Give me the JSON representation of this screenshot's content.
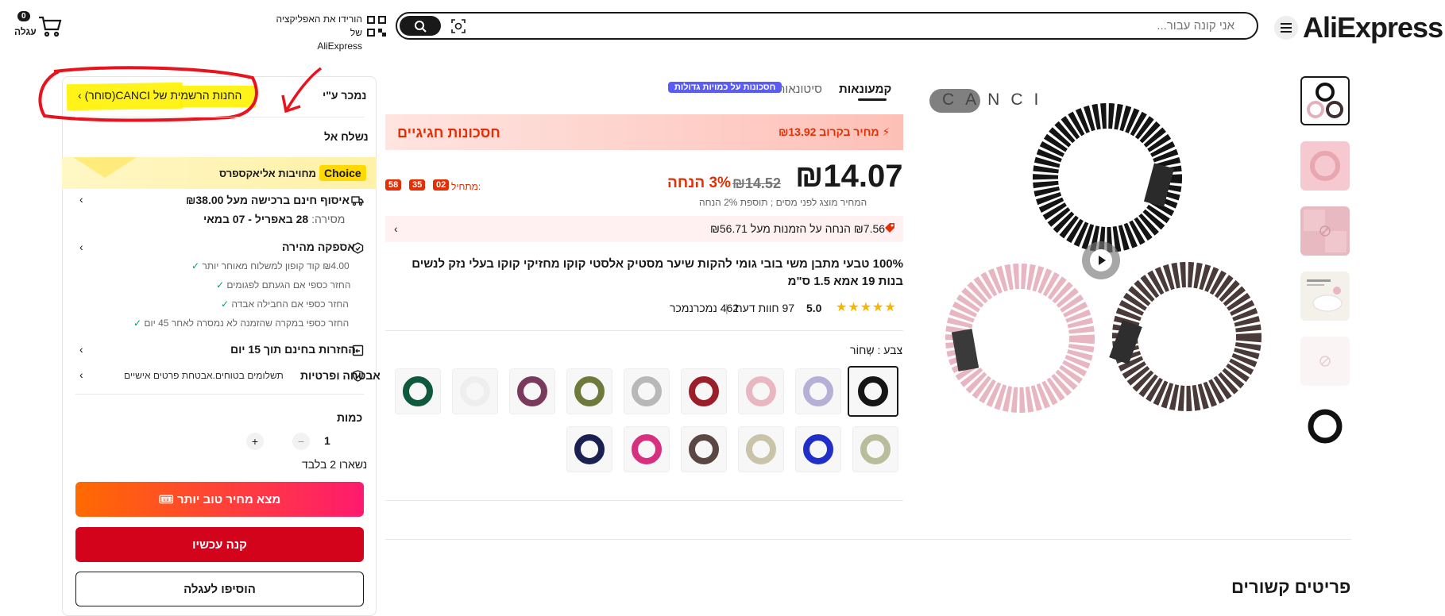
{
  "header": {
    "logo": "AliExpress",
    "search_placeholder": "אני קונה עבור...",
    "app_download_line1": "הורידו את האפליקציה של",
    "app_download_line2": "AliExpress",
    "cart_count": "0",
    "cart_label": "עגלה"
  },
  "gallery": {
    "brand_overlay": "CANCI",
    "thumb_count": 6
  },
  "tabs": {
    "components": "קמעונאות",
    "wholesale": "סיטונאות",
    "bulk_pill": "חסכונות על כמויות גדולות"
  },
  "deal": {
    "title": "חסכונות חגיגיים",
    "upcoming_price": "⚡ מחיר בקרוב ₪13.92"
  },
  "price": {
    "current": "₪14.07",
    "original": "₪14.52",
    "discount": "3% הנחה",
    "tax_note": "המחיר מוצג לפני מסים ; תוספת 2% הנחה",
    "timer_label": "מתחיל:",
    "timer_h": "02",
    "timer_m": "35",
    "timer_s": "58"
  },
  "coupon": {
    "text": "₪7.56 הנחה על הזמנות מעל ₪56.71"
  },
  "product": {
    "title": "100% טבעי מתבן משי בובי גומי להקות שיער מסטיק אלסטי קוקו מחזיקי קוקו בעלי נזק לנשים בנות 19 אמא 1.5 ס\"מ",
    "rating": "5.0",
    "reviews": "97 חוות דעת",
    "sold": "462 נמכרנמכר",
    "color_label": "צבע : שְחוֹר"
  },
  "swatches_row1": [
    "#151515",
    "#b7b0d6",
    "#e8b7c1",
    "#9a1f2a",
    "#b8b8b8",
    "#6e7a3c",
    "#7a3a5c",
    "#eeeeee",
    "#0f5a3c"
  ],
  "swatches_row2": [
    "#b9bd9a",
    "#1f2fc8",
    "#c9c3a9",
    "#5a4642",
    "#d6307f",
    "#1a2050"
  ],
  "seller": {
    "sold_by": "נמכר ע\"י",
    "store": "החנות הרשמית של CANCI(סוחר)",
    "ship_to": "נשלח אל"
  },
  "choice": {
    "badge": "Choice",
    "text": "מחויבות אליאקספרס"
  },
  "shipping": {
    "free": "איסוף חינם ברכישה מעל ₪38.00",
    "delivery_label": "מסירה:",
    "delivery_dates": "28 באפריל - 07 במאי",
    "fast": "אספקה מהירה",
    "checks": [
      "₪4.00 קוד קופון למשלוח מאוחר יותר",
      "החזר כספי אם הגעתם לפגומים",
      "החזר כספי אם החבילה אבדה",
      "החזר כספי במקרה שהזמנה לא נמסרה לאחר 45 יום"
    ],
    "returns": "החזרות בחינם תוך 15 יום",
    "security_title": "אבטחה ופרטיות",
    "security_text": "תשלומים בטוחים.אבטחת פרטים אישיים"
  },
  "purchase": {
    "qty_label": "כמות",
    "qty": "1",
    "stock": "נשארו 2 בלבד",
    "deal_button": "🎟 מצא מחיר טוב יותר",
    "buy_button": "קנה עכשיו",
    "cart_button": "הוסיפו לעגלה"
  },
  "related": {
    "title": "פריטים קשורים"
  },
  "colors": {
    "brand_red": "#fd384f",
    "deal_red": "#e62e04",
    "buy_red": "#d3031c",
    "choice_yellow": "#ffd900",
    "highlight_yellow": "#fff200",
    "annotation_red": "#e8131c"
  }
}
